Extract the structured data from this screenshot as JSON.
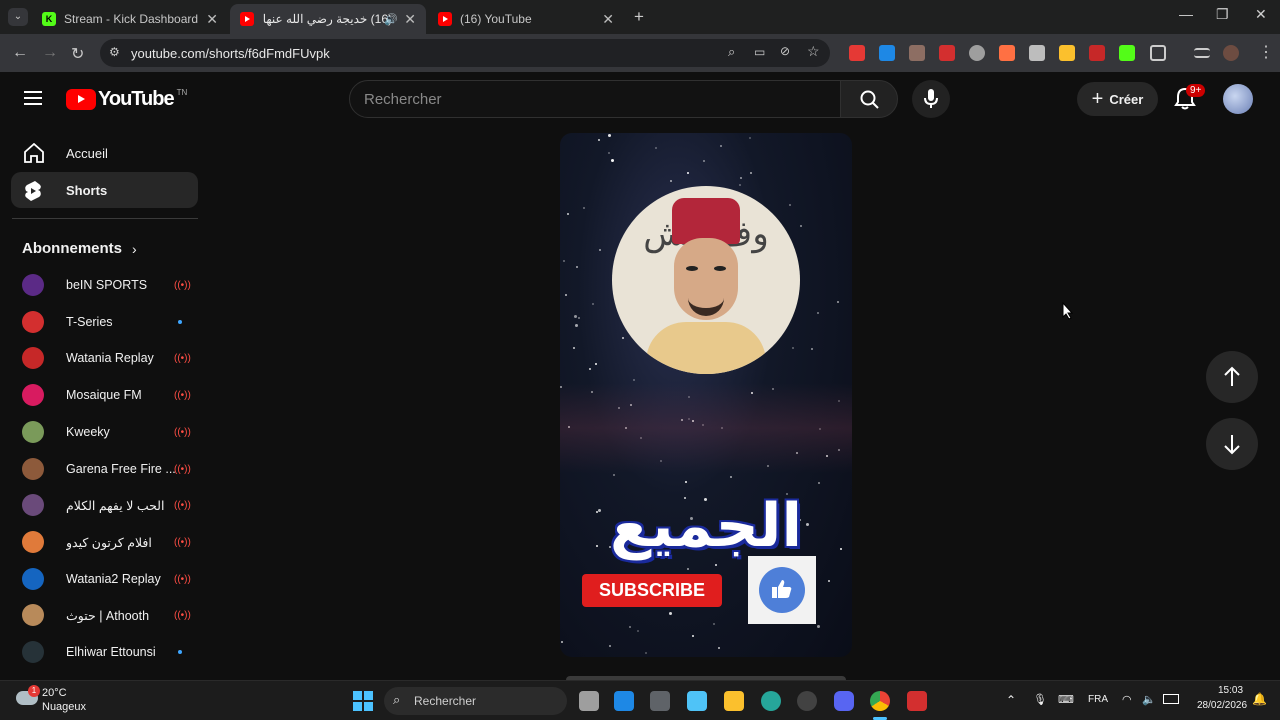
{
  "browser": {
    "tabs": [
      {
        "title": "Stream - Kick Dashboard",
        "favicon": "K"
      },
      {
        "title": "(16) خديجة رضي الله عنها وجا...",
        "favicon": "yt"
      },
      {
        "title": "(16) YouTube",
        "favicon": "yt"
      }
    ],
    "url": "youtube.com/shorts/f6dFmdFUvpk"
  },
  "youtube": {
    "logo_text": "YouTube",
    "logo_sup": "TN",
    "search_placeholder": "Rechercher",
    "create_label": "Créer",
    "notif_badge": "9+"
  },
  "sidebar": {
    "home_label": "Accueil",
    "shorts_label": "Shorts",
    "subs_header": "Abonnements",
    "subscriptions": [
      {
        "name": "beIN SPORTS",
        "status": "live",
        "color": "#5b2a86"
      },
      {
        "name": "T-Series",
        "status": "dot",
        "color": "#d32f2f"
      },
      {
        "name": "Watania Replay",
        "status": "live",
        "color": "#c62828"
      },
      {
        "name": "Mosaique FM",
        "status": "live",
        "color": "#d81b60"
      },
      {
        "name": "Kweeky",
        "status": "live",
        "color": "#7a9a5a"
      },
      {
        "name": "Garena Free Fire ...",
        "status": "live",
        "color": "#8d5a3b"
      },
      {
        "name": "الحب لا يفهم الكلام",
        "status": "live",
        "color": "#6a4a7a"
      },
      {
        "name": "افلام كرتون كيدو",
        "status": "live",
        "color": "#e07a3a"
      },
      {
        "name": "Watania2 Replay",
        "status": "live",
        "color": "#1565c0"
      },
      {
        "name": "حتوث | Athooth",
        "status": "live",
        "color": "#b88a5a"
      },
      {
        "name": "Elhiwar Ettounsi",
        "status": "dot",
        "color": "#263238"
      }
    ]
  },
  "short": {
    "overlay_arabic": "الجميع",
    "subscribe_label": "SUBSCRIBE",
    "circle_text": "وف الش"
  },
  "taskbar": {
    "weather_temp": "20°C",
    "weather_desc": "Nuageux",
    "weather_badge": "1",
    "search_label": "Rechercher",
    "lang": "FRA",
    "time": "15:03",
    "date": "28/02/2026"
  }
}
